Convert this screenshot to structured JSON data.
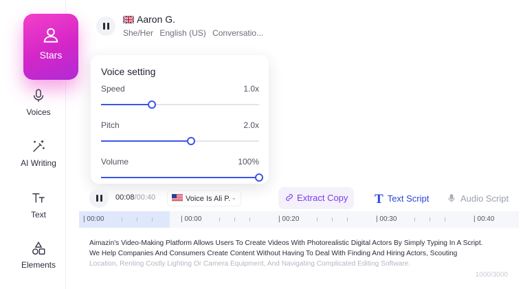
{
  "sidebar": {
    "items": [
      {
        "label": "Stars",
        "icon": "user-icon",
        "active": true
      },
      {
        "label": "Voices",
        "icon": "microphone-icon"
      },
      {
        "label": "AI Writing",
        "icon": "magic-wand-icon"
      },
      {
        "label": "Text",
        "icon": "text-icon"
      },
      {
        "label": "Elements",
        "icon": "shapes-icon"
      }
    ]
  },
  "voice": {
    "name": "Aaron G.",
    "flag": "uk-flag-icon",
    "pronoun": "She/Her",
    "language": "English (US)",
    "style": "Conversatio..."
  },
  "voice_setting": {
    "title": "Voice setting",
    "speed": {
      "label": "Speed",
      "value": "1.0x",
      "level": 0.32
    },
    "pitch": {
      "label": "Pitch",
      "value": "2.0x",
      "level": 0.57
    },
    "volume": {
      "label": "Volume",
      "value": "100%",
      "level": 1.0
    }
  },
  "player": {
    "current_time": "00:08",
    "total_time": "/00:40",
    "voice_select": "Voice Is Ali P.",
    "extract_label": "Extract Copy",
    "tab_text_script": "Text Script",
    "tab_audio_script": "Audio Script"
  },
  "timeline": {
    "labels": [
      "| 00:00",
      "| 00:00",
      "| 00:20",
      "| 00:30",
      "| 00:40"
    ]
  },
  "script": {
    "line1": "Aimazin's Video-Making Platform Allows Users To Create Videos With Photorealistic Digital Actors By Simply Typing In A Script.",
    "line2": "We Help Companies And Consumers Create Content Without Having To Deal With Finding And Hiring Actors, Scouting",
    "line3": "Location, Renting Costly Lighting Or Camera Equipment, And Navigating Complicated Editing Software.",
    "count": "1000/3000"
  },
  "colors": {
    "accent": "#3a55e6",
    "brand_pink": "#e43ac8",
    "extract": "#7a3cf0"
  }
}
